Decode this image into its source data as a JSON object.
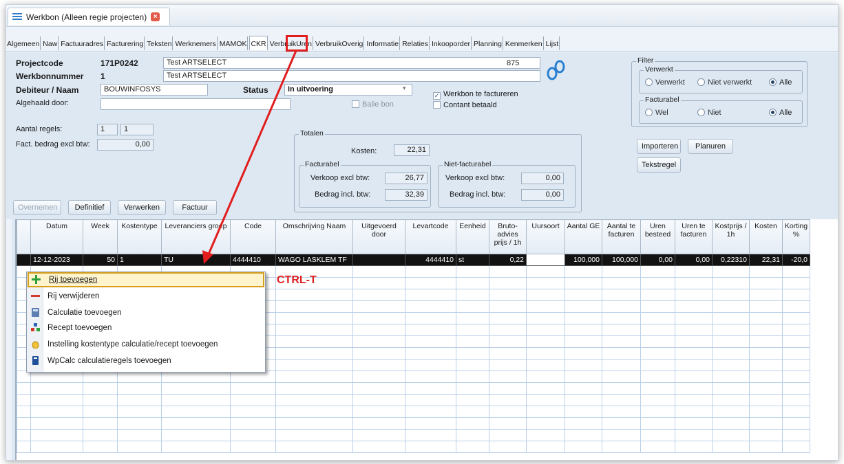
{
  "window": {
    "title": "Werkbon (Alleen regie projecten)"
  },
  "tabs": [
    "Algemeen",
    "Naw",
    "Factuuradres",
    "Facturering",
    "Teksten",
    "Werknemers",
    "MAMOK",
    "CKR",
    "VerbruikUren",
    "VerbruikOverig",
    "Informatie",
    "Relaties",
    "Inkooporder",
    "Planning",
    "Kenmerken",
    "Lijst"
  ],
  "active_tab": "CKR",
  "form": {
    "projectcode_label": "Projectcode",
    "projectcode": "171P0242",
    "project_name": "Test ARTSELECT",
    "project_number": "875",
    "werkbon_label": "Werkbonnummer",
    "werkbon_nr": "1",
    "werkbon_name": "Test ARTSELECT",
    "debiteur_label": "Debiteur / Naam",
    "debiteur": "BOUWINFOSYS",
    "status_label": "Status",
    "status_value": "In uitvoering",
    "algehaald_label": "Algehaald door:",
    "balie_label": "Balie bon",
    "werkbon_factureren_label": "Werkbon te factureren",
    "contant_label": "Contant betaald",
    "aantal_regels_label": "Aantal regels:",
    "aantal_regels_1": "1",
    "aantal_regels_2": "1",
    "fact_bedrag_label": "Fact. bedrag excl btw:",
    "fact_bedrag": "0,00"
  },
  "totalen": {
    "title": "Totalen",
    "kosten_label": "Kosten:",
    "kosten": "22,31",
    "facturabel_title": "Facturabel",
    "verkoop_label": "Verkoop excl btw:",
    "verkoop": "26,77",
    "bedrag_label": "Bedrag incl. btw:",
    "bedrag": "32,39",
    "niet_title": "Niet-facturabel",
    "niet_verkoop_label": "Verkoop excl btw:",
    "niet_verkoop": "0,00",
    "niet_bedrag_label": "Bedrag incl. btw:",
    "niet_bedrag": "0,00"
  },
  "filter": {
    "title": "Filter",
    "verwerkt_title": "Verwerkt",
    "verwerkt_options": [
      "Verwerkt",
      "Niet verwerkt",
      "Alle"
    ],
    "facturabel_title": "Facturabel",
    "facturabel_options": [
      "Wel",
      "Niet",
      "Alle"
    ]
  },
  "buttons": {
    "importeren": "Importeren",
    "planuren": "Planuren",
    "tekstregel": "Tekstregel",
    "overnemen": "Overnemen",
    "definitief": "Definitief",
    "verwerken": "Verwerken",
    "factuur": "Factuur"
  },
  "grid": {
    "columns": [
      "Datum",
      "Week",
      "Kostentype",
      "Leveranciers groep",
      "Code",
      "Omschrijving Naam",
      "Uitgevoerd door",
      "Levartcode",
      "Eenheid",
      "Bruto-advies prijs / 1h",
      "Uursoort",
      "Aantal GE",
      "Aantal te facturen",
      "Uren besteed",
      "Uren te facturen",
      "Kostprijs / 1h",
      "Kosten",
      "Korting %"
    ],
    "rows": [
      [
        "12-12-2023",
        "50",
        "1",
        "TU",
        "4444410",
        "WAGO LASKLEM TF",
        "",
        "4444410",
        "st",
        "0,22",
        "",
        "100,000",
        "100,000",
        "0,00",
        "0,00",
        "0,22310",
        "22,31",
        "-20,0"
      ]
    ]
  },
  "context_menu": [
    {
      "label": "Rij toevoegen",
      "icon": "plus-icon"
    },
    {
      "label": "Rij verwijderen",
      "icon": "minus-icon"
    },
    {
      "label": "Calculatie toevoegen",
      "icon": "calculator-icon"
    },
    {
      "label": "Recept toevoegen",
      "icon": "recipe-icon"
    },
    {
      "label": "Instelling kostentype calculatie/recept toevoegen",
      "icon": "settings-bag-icon"
    },
    {
      "label": "WpCalc calculatieregels toevoegen",
      "icon": "wpcalc-icon"
    }
  ],
  "annotation": {
    "shortcut": "CTRL-T"
  },
  "colors": {
    "highlight_red": "#e11d1d",
    "panel_bg": "#dde8f3",
    "selected_row": "#121212"
  }
}
